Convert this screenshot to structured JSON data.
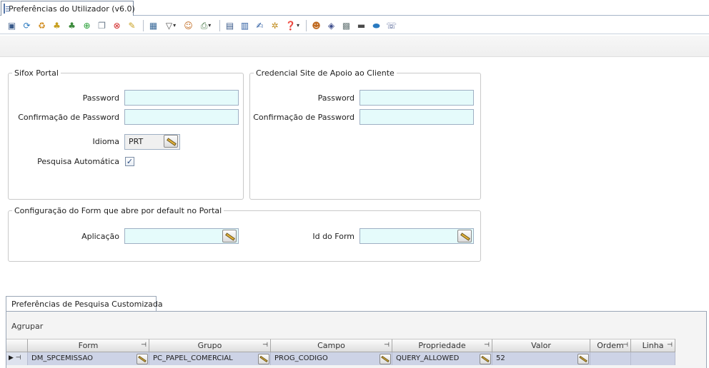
{
  "window_tab": {
    "title": "Preferências do Utilizador (v6.0)"
  },
  "toolbar": {
    "icons": [
      "save-icon",
      "refresh-icon",
      "recycle-icon",
      "group-icon",
      "group-add-icon",
      "add-icon",
      "copy-icon",
      "delete-icon",
      "note-icon",
      "export-icon",
      "filter-icon",
      "user-icon",
      "print-icon",
      "calendar-icon",
      "calculator-icon",
      "edit-doc-icon",
      "settings-icon",
      "help-icon",
      "users-icon",
      "shield-icon",
      "database-icon",
      "card-icon",
      "link-icon",
      "phone-icon"
    ]
  },
  "sifox_portal": {
    "legend": "Sifox Portal",
    "password_label": "Password",
    "password_value": "",
    "confirm_label": "Confirmação de Password",
    "confirm_value": "",
    "idioma_label": "Idioma",
    "idioma_value": "PRT",
    "pesquisa_label": "Pesquisa Automática",
    "pesquisa_checked": true
  },
  "credencial": {
    "legend": "Credencial Site de Apoio ao Cliente",
    "password_label": "Password",
    "password_value": "",
    "confirm_label": "Confirmação de Password",
    "confirm_value": ""
  },
  "config_form": {
    "legend": "Configuração do Form que abre por default no Portal",
    "aplicacao_label": "Aplicação",
    "aplicacao_value": "",
    "idform_label": "Id do Form",
    "idform_value": ""
  },
  "bottom_tab": {
    "label": "Preferências de Pesquisa Customizada"
  },
  "grid": {
    "group_label": "Agrupar",
    "pin_glyph": "⊣",
    "columns": [
      "Form",
      "Grupo",
      "Campo",
      "Propriedade",
      "Valor",
      "Ordem",
      "Linha"
    ],
    "rows": [
      {
        "indicator": "▶ ⊣",
        "form": "DM_SPCEMISSAO",
        "grupo": "PC_PAPEL_COMERCIAL",
        "campo": "PROG_CODIGO",
        "propriedade": "QUERY_ALLOWED",
        "valor": "52",
        "ordem": "",
        "linha": ""
      }
    ]
  }
}
